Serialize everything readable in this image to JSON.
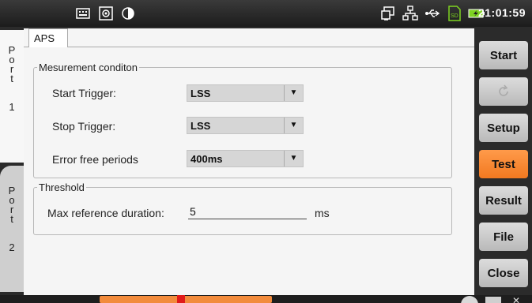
{
  "status_bar": {
    "time": "21:01:59",
    "icons": [
      "keyboard-icon",
      "screenshot-icon",
      "contrast-icon",
      "remote-icon",
      "network-icon",
      "usb-icon",
      "sd-card-icon",
      "battery-charging-icon"
    ],
    "sd_label": "SD"
  },
  "ports": [
    {
      "letters": [
        "P",
        "o",
        "r",
        "t"
      ],
      "number": "1"
    },
    {
      "letters": [
        "P",
        "o",
        "r",
        "t"
      ],
      "number": "2"
    }
  ],
  "tab": {
    "label": "APS"
  },
  "measurement": {
    "legend": "Mesurement conditon",
    "rows": [
      {
        "label": "Start Trigger:",
        "value": "LSS"
      },
      {
        "label": "Stop Trigger:",
        "value": "LSS"
      },
      {
        "label": "Error free periods",
        "value": "400ms"
      }
    ]
  },
  "threshold": {
    "legend": "Threshold",
    "label": "Max reference duration:",
    "value": "5",
    "unit": "ms"
  },
  "right_buttons": {
    "start": "Start",
    "setup": "Setup",
    "test": "Test",
    "result": "Result",
    "file": "File",
    "close": "Close"
  },
  "colors": {
    "accent": "#f27920",
    "button": "#c8c8c8",
    "statusbar": "#2a2a2a"
  }
}
